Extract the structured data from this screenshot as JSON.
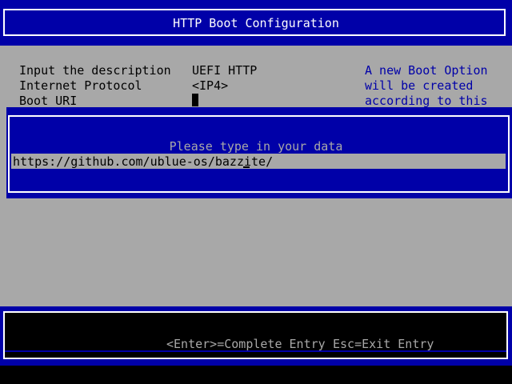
{
  "header": {
    "title": "HTTP Boot Configuration"
  },
  "form": {
    "rows": [
      {
        "label": "Input the description",
        "value": "UEFI HTTP"
      },
      {
        "label": "Internet Protocol",
        "value": "<IP4>"
      },
      {
        "label": "Boot URI",
        "value": ""
      }
    ]
  },
  "help": {
    "lines": [
      "A new Boot Option",
      "will be created",
      "according to this"
    ]
  },
  "popup": {
    "prompt": "Please type in your data",
    "input_value": "https://github.com/ublue-os/bazzite/"
  },
  "footer": {
    "enter_hint": "<Enter>=Complete Entry",
    "esc_hint": "Esc=Exit Entry"
  },
  "colors": {
    "blue": "#0000a8",
    "gray": "#a8a8a8",
    "white": "#ffffff",
    "black": "#000000",
    "help_text": "#0000a8",
    "label_text": "#000000"
  }
}
